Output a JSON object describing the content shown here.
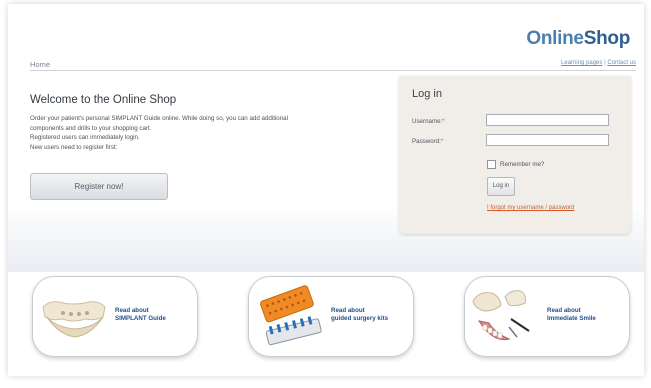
{
  "brand": {
    "part1": "Online",
    "part2": "Shop"
  },
  "topbar": {
    "home": "Home",
    "learning": "Learning pages",
    "separator": " | ",
    "contact": "Contact us"
  },
  "welcome": {
    "title": "Welcome to the Online Shop",
    "lines": [
      "Order your patient's personal SIMPLANT Guide online. While doing so, you can add additional",
      "components and drills to your shopping cart.",
      "Registered users can immediately login.",
      "New users need to register first:"
    ],
    "register_label": "Register now!"
  },
  "login": {
    "title": "Log in",
    "username_label": "Username:",
    "password_label": "Password:",
    "required_mark": "*",
    "remember_label": "Remember me?",
    "button_label": "Log in",
    "forgot_label": "I forgot my username / password"
  },
  "cards": [
    {
      "line1": "Read about",
      "line2": "SIMPLANT Guide",
      "icon": "dental-guide-icon"
    },
    {
      "line1": "Read about",
      "line2": "guided surgery kits",
      "icon": "surgery-kit-icon"
    },
    {
      "line1": "Read about",
      "line2": "Immediate Smile",
      "icon": "immediate-smile-icon"
    }
  ],
  "colors": {
    "accent": "#2f5f93",
    "link_orange": "#d25b2a",
    "login_bg": "#f1ede8",
    "card_text": "#1e4f8e"
  }
}
